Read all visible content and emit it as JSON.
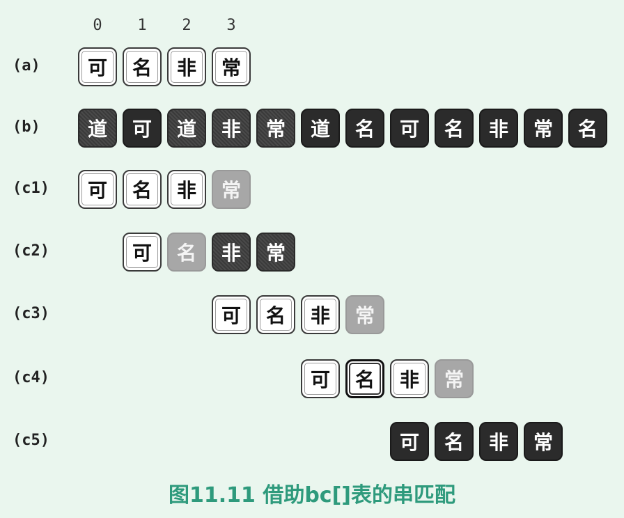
{
  "indices": [
    "0",
    "1",
    "2",
    "3"
  ],
  "rows": [
    {
      "label": "(a)",
      "cells": [
        {
          "char": "可",
          "style": "white"
        },
        {
          "char": "名",
          "style": "white"
        },
        {
          "char": "非",
          "style": "white"
        },
        {
          "char": "常",
          "style": "white"
        }
      ]
    },
    {
      "label": "(b)",
      "cells": [
        {
          "char": "道",
          "style": "noisy"
        },
        {
          "char": "可",
          "style": "dark"
        },
        {
          "char": "道",
          "style": "noisy"
        },
        {
          "char": "非",
          "style": "noisy"
        },
        {
          "char": "常",
          "style": "noisy"
        },
        {
          "char": "道",
          "style": "dark"
        },
        {
          "char": "名",
          "style": "dark"
        },
        {
          "char": "可",
          "style": "dark"
        },
        {
          "char": "名",
          "style": "dark"
        },
        {
          "char": "非",
          "style": "dark"
        },
        {
          "char": "常",
          "style": "dark"
        },
        {
          "char": "名",
          "style": "dark"
        }
      ]
    },
    {
      "label": "(c1)",
      "cells": [
        {
          "char": "可",
          "style": "white"
        },
        {
          "char": "名",
          "style": "white"
        },
        {
          "char": "非",
          "style": "white"
        },
        {
          "char": "常",
          "style": "grey"
        }
      ]
    },
    {
      "label": "(c2)",
      "cells": [
        {
          "char": "可",
          "style": "white"
        },
        {
          "char": "名",
          "style": "grey"
        },
        {
          "char": "非",
          "style": "noisy"
        },
        {
          "char": "常",
          "style": "noisy"
        }
      ]
    },
    {
      "label": "(c3)",
      "cells": [
        {
          "char": "可",
          "style": "white"
        },
        {
          "char": "名",
          "style": "white"
        },
        {
          "char": "非",
          "style": "white"
        },
        {
          "char": "常",
          "style": "grey"
        }
      ]
    },
    {
      "label": "(c4)",
      "cells": [
        {
          "char": "可",
          "style": "white"
        },
        {
          "char": "名",
          "style": "bold"
        },
        {
          "char": "非",
          "style": "white"
        },
        {
          "char": "常",
          "style": "grey"
        }
      ]
    },
    {
      "label": "(c5)",
      "cells": [
        {
          "char": "可",
          "style": "dark"
        },
        {
          "char": "名",
          "style": "dark"
        },
        {
          "char": "非",
          "style": "dark"
        },
        {
          "char": "常",
          "style": "dark"
        }
      ]
    }
  ],
  "caption": "图11.11 借助bc[]表的串匹配"
}
